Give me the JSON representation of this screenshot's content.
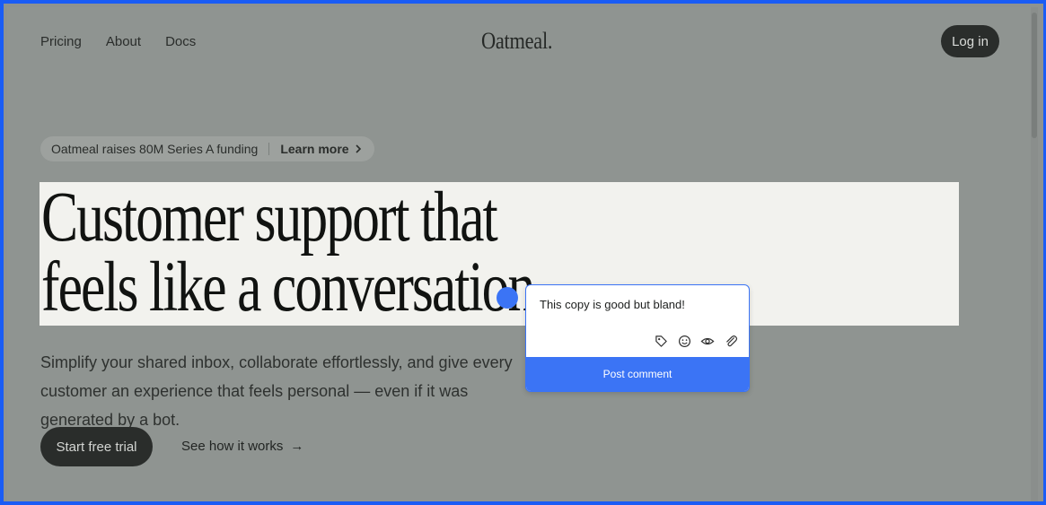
{
  "nav": {
    "links": [
      "Pricing",
      "About",
      "Docs"
    ],
    "logo": "Oatmeal.",
    "login": "Log in"
  },
  "announcement": {
    "text": "Oatmeal raises 80M Series A funding",
    "link": "Learn more"
  },
  "hero": {
    "headline_line1": "Customer support that",
    "headline_line2": "feels like a conversation",
    "subtext": "Simplify your shared inbox, collaborate effortlessly, and give every customer an experience that feels personal — even if it was generated by a bot.",
    "primary_cta": "Start free trial",
    "secondary_cta": "See how it works",
    "secondary_arrow": "→"
  },
  "comment": {
    "text": "This copy is good but bland!",
    "post_label": "Post comment",
    "tools": [
      "tag-icon",
      "emoji-icon",
      "eye-icon",
      "paperclip-icon"
    ]
  },
  "colors": {
    "accent": "#3b74f5",
    "frame": "#1a5cf5",
    "overlay": "#8f9491",
    "highlight": "#f2f2ee"
  }
}
